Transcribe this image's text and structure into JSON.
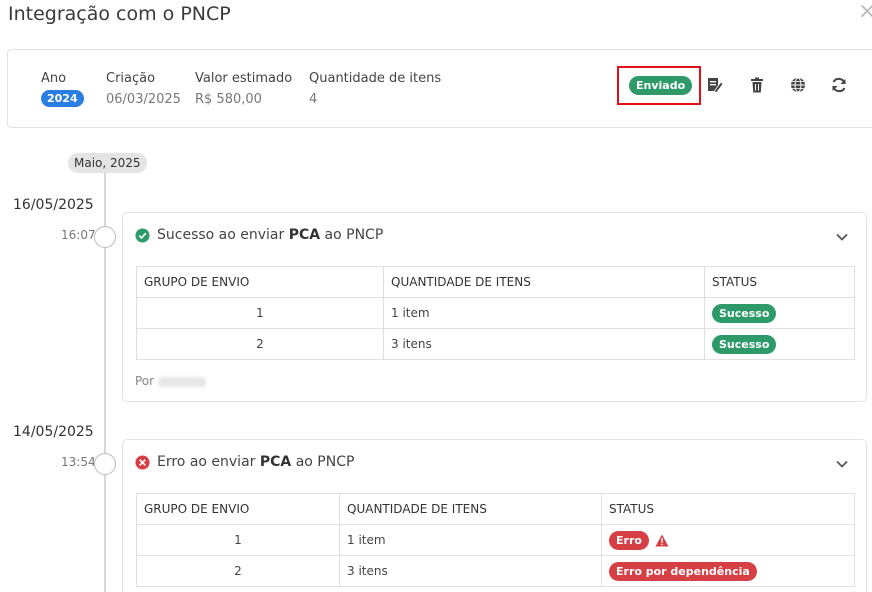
{
  "modal": {
    "title": "Integração com o PNCP",
    "close": "×"
  },
  "summary": {
    "ano_label": "Ano",
    "ano_value": "2024",
    "criacao_label": "Criação",
    "criacao_value": "06/03/2025",
    "valor_label": "Valor estimado",
    "valor_value": "R$ 580,00",
    "quantidade_label": "Quantidade de itens",
    "quantidade_value": "4",
    "status": "Enviado",
    "status_color": "#2e9a6a",
    "highlight_color": "#e0101a",
    "actions": [
      "edit-document-icon",
      "trash-icon",
      "globe-icon",
      "refresh-icon"
    ]
  },
  "timeline": {
    "month": "Maio, 2025",
    "events": [
      {
        "date": "16/05/2025",
        "time": "16:07",
        "icon": "check-circle-icon",
        "title_prefix": "Sucesso ao enviar ",
        "title_bold": "PCA",
        "title_suffix": " ao PNCP",
        "headers": [
          "GRUPO DE ENVIO",
          "QUANTIDADE DE ITENS",
          "STATUS"
        ],
        "rows": [
          {
            "grupo": "1",
            "quantidade": "1 item",
            "status": "Sucesso"
          },
          {
            "grupo": "2",
            "quantidade": "3 itens",
            "status": "Sucesso"
          }
        ],
        "by_label": "Por"
      },
      {
        "date": "14/05/2025",
        "time": "13:54",
        "icon": "error-circle-icon",
        "title_prefix": "Erro ao enviar ",
        "title_bold": "PCA",
        "title_suffix": " ao PNCP",
        "headers": [
          "GRUPO DE ENVIO",
          "QUANTIDADE DE ITENS",
          "STATUS"
        ],
        "rows": [
          {
            "grupo": "1",
            "quantidade": "1 item",
            "status": "Erro"
          },
          {
            "grupo": "2",
            "quantidade": "3 itens",
            "status": "Erro por dependência"
          }
        ]
      }
    ]
  },
  "colors": {
    "success": "#2e9a6a",
    "error": "#d64045",
    "year_badge": "#2a7de1"
  }
}
